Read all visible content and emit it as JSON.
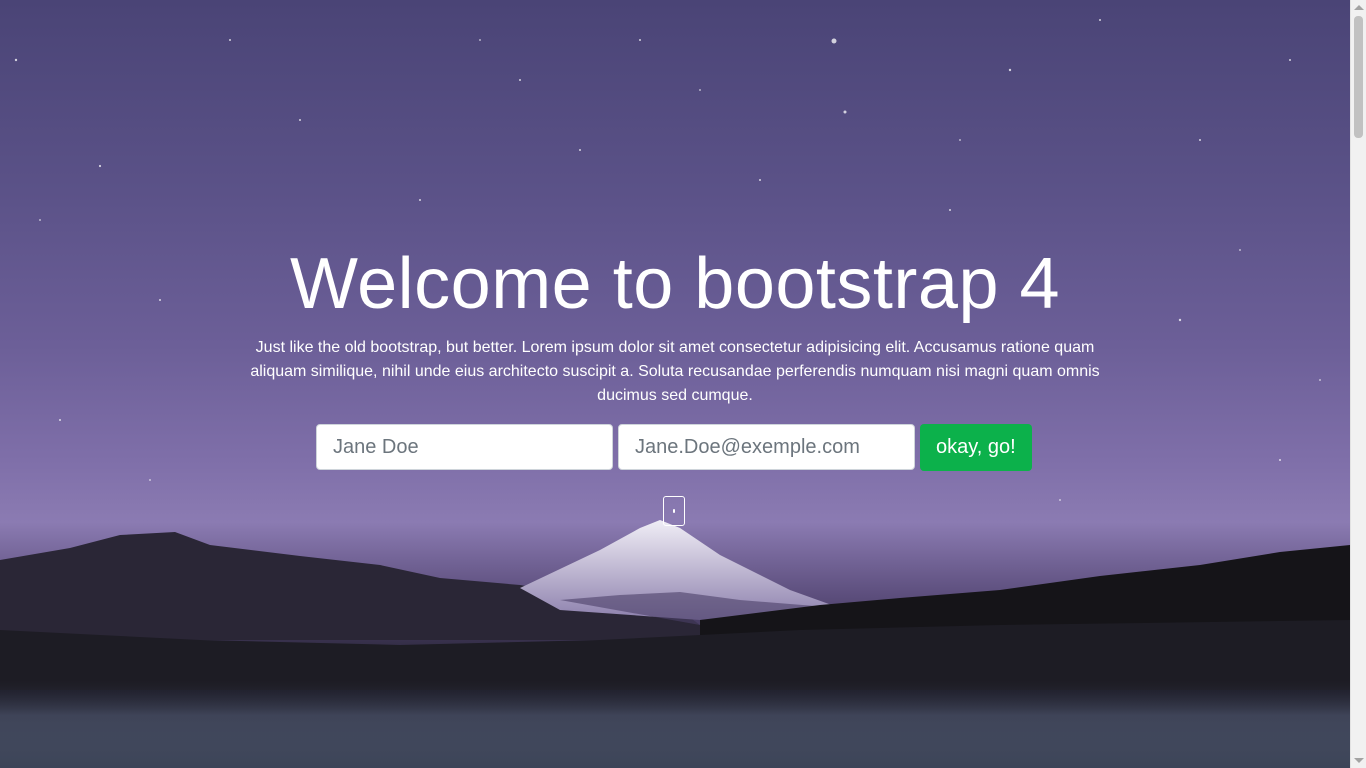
{
  "hero": {
    "title": "Welcome to bootstrap 4",
    "lead": "Just like the old bootstrap, but better. Lorem ipsum dolor sit amet consectetur adipisicing elit. Accusamus ratione quam aliquam similique, nihil unde eius architecto suscipit a. Soluta recusandae perferendis numquam nisi magni quam omnis ducimus sed cumque."
  },
  "form": {
    "name_placeholder": "Jane Doe",
    "email_placeholder": "Jane.Doe@exemple.com",
    "submit_label": "okay, go!"
  },
  "colors": {
    "accent": "#0cb14b",
    "text": "#ffffff"
  },
  "icons": {
    "scroll_indicator": "mouse-scroll-icon"
  }
}
